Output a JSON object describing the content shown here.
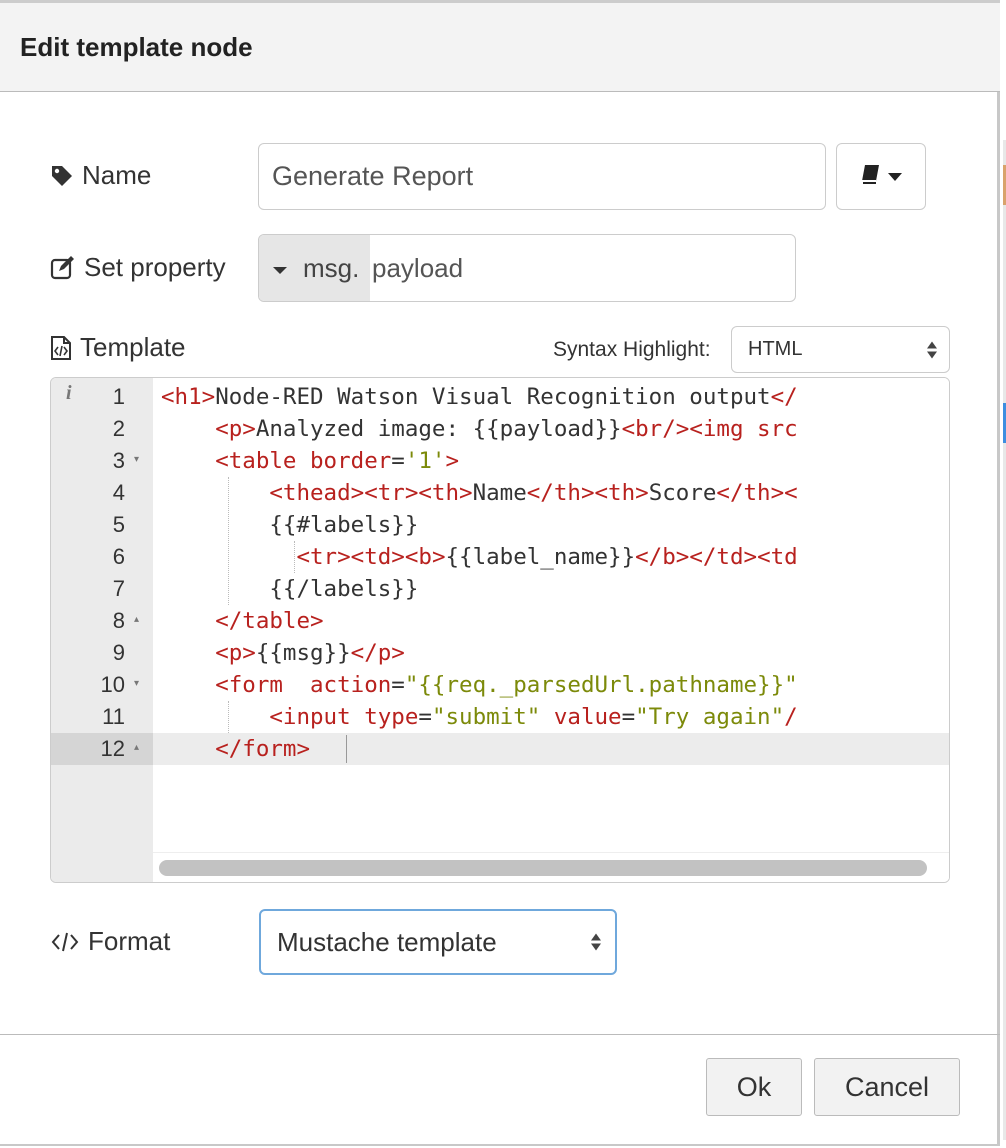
{
  "dialog": {
    "title": "Edit template node"
  },
  "name": {
    "label": "Name",
    "value": "Generate Report",
    "icon": "tag-icon",
    "library_icon": "book-icon"
  },
  "property": {
    "label": "Set property",
    "icon": "edit-icon",
    "prefix": "msg.",
    "value": "payload"
  },
  "template": {
    "label": "Template",
    "icon": "file-code-icon",
    "syntax_label": "Syntax Highlight:",
    "syntax_value": "HTML",
    "active_line": 12,
    "lines": [
      "<h1>Node-RED Watson Visual Recognition output</",
      "    <p>Analyzed image: {{payload}}<br/><img src",
      "    <table border='1'>",
      "        <thead><tr><th>Name</th><th>Score</th><",
      "        {{#labels}}",
      "          <tr><td><b>{{label_name}}</b></td><td",
      "        {{/labels}}",
      "    </table>",
      "    <p>{{msg}}</p>",
      "    <form  action=\"{{req._parsedUrl.pathname}}\"",
      "        <input type=\"submit\" value=\"Try again\"/",
      "    </form>"
    ]
  },
  "format": {
    "label": "Format",
    "icon": "code-icon",
    "value": "Mustache template"
  },
  "buttons": {
    "ok": "Ok",
    "cancel": "Cancel"
  },
  "colors": {
    "tag": "#b8211e",
    "string": "#7c8a0a",
    "focus": "#6fa8dc"
  }
}
